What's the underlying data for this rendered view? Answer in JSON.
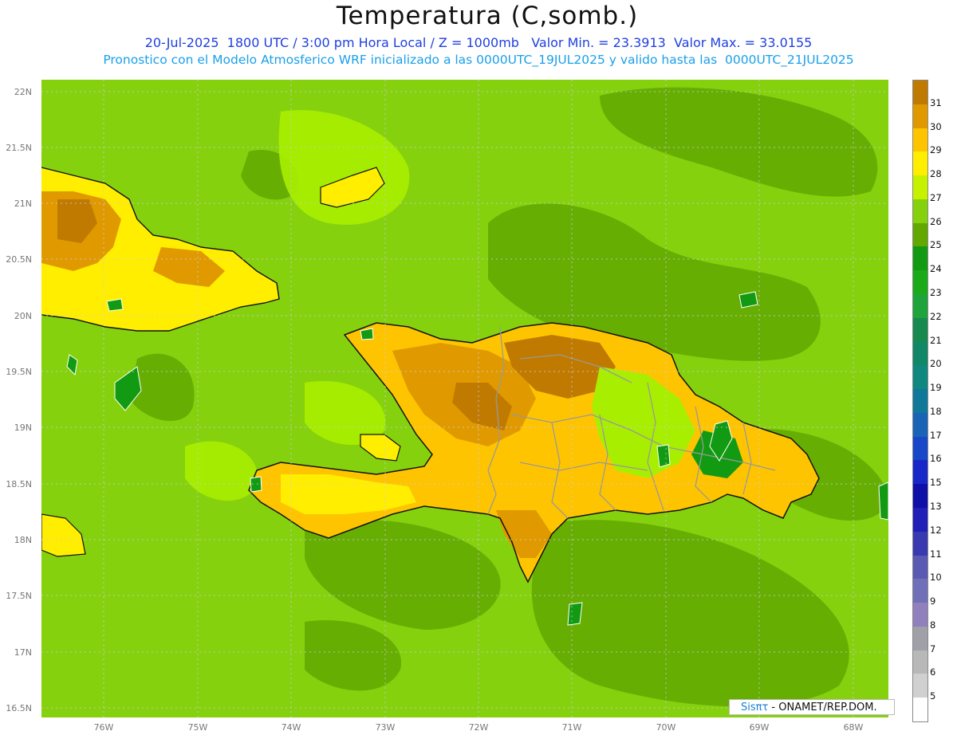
{
  "title": "Temperatura (C,somb.)",
  "subtitle_line1": "20-Jul-2025  1800 UTC / 3:00 pm Hora Local / Z = 1000mb   Valor Min. = 23.3913  Valor Max. = 33.0155",
  "subtitle_line2": "Pronostico con el Modelo Atmosferico WRF inicializado a las 0000UTC_19JUL2025 y valido hasta las  0000UTC_21JUL2025",
  "credit": {
    "brand": "Sisπτ",
    "text": " - ONAMET/REP.DOM."
  },
  "lat_labels": [
    "22N",
    "21.5N",
    "21N",
    "20.5N",
    "20N",
    "19.5N",
    "19N",
    "18.5N",
    "18N",
    "17.5N",
    "17N",
    "16.5N"
  ],
  "lon_labels": [
    "76W",
    "75W",
    "74W",
    "73W",
    "72W",
    "71W",
    "70W",
    "69W",
    "68W"
  ],
  "colorbar": {
    "labels": [
      "31",
      "30",
      "29",
      "28",
      "27",
      "26",
      "25",
      "24",
      "23",
      "22",
      "21",
      "20",
      "19",
      "18",
      "17",
      "16",
      "15",
      "13",
      "12",
      "11",
      "10",
      "9",
      "8",
      "7",
      "6",
      "5"
    ],
    "colors": [
      "#c07a00",
      "#e09a00",
      "#ffc400",
      "#ffee00",
      "#c6f200",
      "#86d10e",
      "#62a800",
      "#129a12",
      "#1aaa1a",
      "#1fa43c",
      "#188a50",
      "#108868",
      "#108880",
      "#107898",
      "#1a64b8",
      "#1848c8",
      "#1828c8",
      "#0f10a8",
      "#2020b8",
      "#3a3ab0",
      "#5a5ab4",
      "#7070b8",
      "#9080bc",
      "#a0a0a8",
      "#b8b8b8",
      "#d0d0d0",
      "#ffffff"
    ]
  }
}
